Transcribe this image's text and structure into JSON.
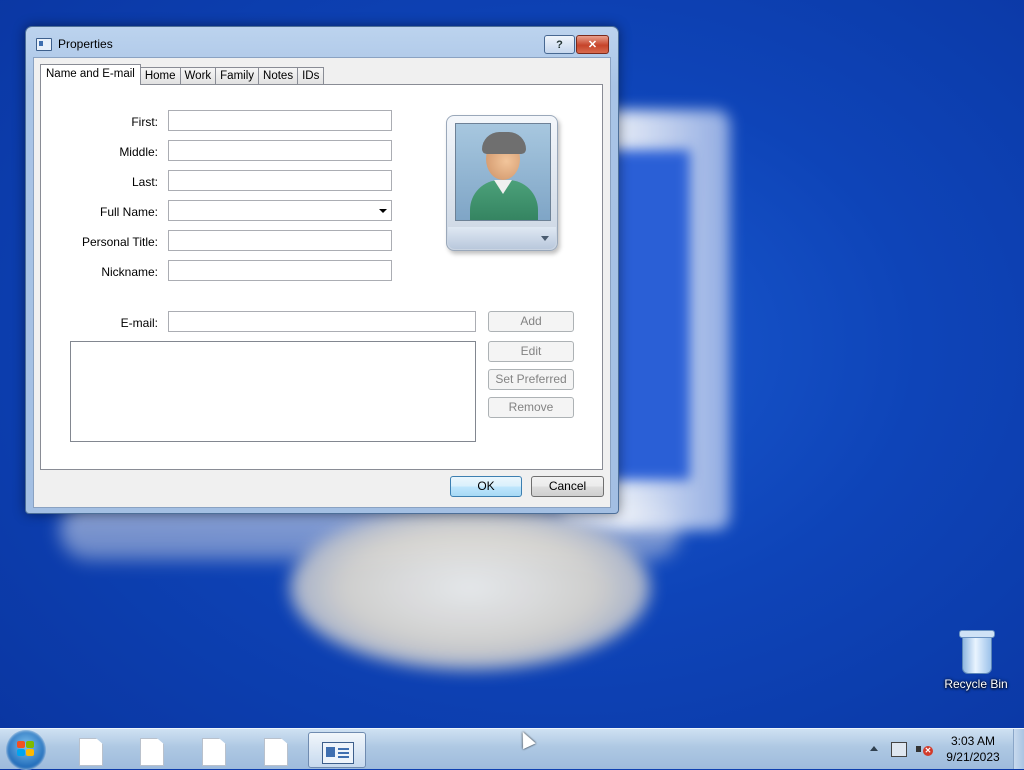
{
  "desktop": {
    "icons": [
      {
        "label": "Recycle Bin",
        "icon": "recycle-bin-icon"
      }
    ]
  },
  "dialog": {
    "title": "Properties",
    "help_label": "?",
    "close_label": "✕",
    "tabs": [
      {
        "label": "Name and E-mail",
        "active": true
      },
      {
        "label": "Home"
      },
      {
        "label": "Work"
      },
      {
        "label": "Family"
      },
      {
        "label": "Notes"
      },
      {
        "label": "IDs"
      }
    ],
    "fields": {
      "first": {
        "label": "First:",
        "value": ""
      },
      "middle": {
        "label": "Middle:",
        "value": ""
      },
      "last": {
        "label": "Last:",
        "value": ""
      },
      "full_name": {
        "label": "Full Name:",
        "value": ""
      },
      "personal_title": {
        "label": "Personal Title:",
        "value": ""
      },
      "nickname": {
        "label": "Nickname:",
        "value": ""
      },
      "email": {
        "label": "E-mail:",
        "value": ""
      }
    },
    "email_list": [],
    "email_buttons": {
      "add": "Add",
      "edit": "Edit",
      "set_preferred": "Set Preferred",
      "remove": "Remove"
    },
    "footer": {
      "ok": "OK",
      "cancel": "Cancel"
    }
  },
  "taskbar": {
    "items": [
      {
        "icon": "document-icon"
      },
      {
        "icon": "document-icon"
      },
      {
        "icon": "document-icon"
      },
      {
        "icon": "document-icon"
      },
      {
        "icon": "contact-card-icon",
        "active": true
      }
    ],
    "clock": {
      "time": "3:03 AM",
      "date": "9/21/2023"
    }
  },
  "colors": {
    "desktop_blue": "#0e44b8",
    "titlebar": "#bcd3ee",
    "close_button": "#c6442a",
    "taskbar": "#aec8e3"
  }
}
